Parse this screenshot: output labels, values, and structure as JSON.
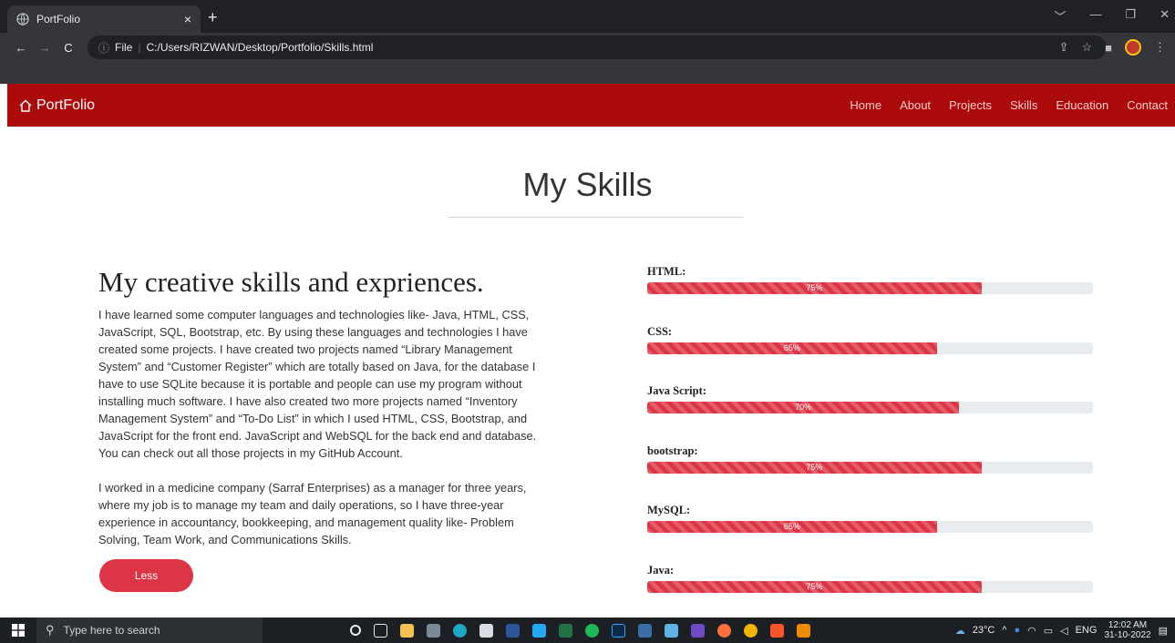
{
  "browser": {
    "tab_title": "PortFolio",
    "tab_close": "×",
    "new_tab": "+",
    "address_scheme": "File",
    "address_path": "C:/Users/RIZWAN/Desktop/Portfolio/Skills.html",
    "window_controls": [
      "﹀",
      "—",
      "❐",
      "✕"
    ]
  },
  "nav": {
    "brand": "PortFolio",
    "links": [
      "Home",
      "About",
      "Projects",
      "Skills",
      "Education",
      "Contact"
    ]
  },
  "page": {
    "title": "My Skills",
    "intro_heading": "My creative skills and expriences.",
    "paragraph1": "I have learned some computer languages and technologies like- Java, HTML, CSS, JavaScript, SQL, Bootstrap, etc. By using these languages and technologies I have created some projects. I have created two projects named “Library Management System” and “Customer Register” which are totally based on Java, for the database I have to use SQLite because it is portable and people can use my program without installing much software. I have also created two more projects named “Inventory Management System” and “To-Do List” in which I used HTML, CSS, Bootstrap, and JavaScript for the front end. JavaScript and WebSQL for the back end and database. You can check out all those projects in my GitHub Account.",
    "paragraph2": "I worked in a medicine company (Sarraf Enterprises) as a manager for three years, where my job is to manage my team and daily operations, so I have three-year experience in accountancy, bookkeeping, and management quality like- Problem Solving, Team Work, and Communications Skills.",
    "less_label": "Less"
  },
  "skills": [
    {
      "name": "HTML:",
      "percent": 75,
      "label": "75%"
    },
    {
      "name": "CSS:",
      "percent": 65,
      "label": "65%"
    },
    {
      "name": "Java Script:",
      "percent": 70,
      "label": "70%"
    },
    {
      "name": "bootstrap:",
      "percent": 75,
      "label": "75%"
    },
    {
      "name": "MySQL:",
      "percent": 65,
      "label": "65%"
    },
    {
      "name": "Java:",
      "percent": 75,
      "label": "75%"
    }
  ],
  "colors": {
    "nav_bg": "#ab0b0b",
    "accent": "#dc3545",
    "track": "#e9ecef"
  },
  "taskbar": {
    "search_placeholder": "Type here to search",
    "temperature": "23°C",
    "language": "ENG",
    "time": "12:02 AM",
    "date": "31-10-2022",
    "app_icons": [
      "cortana-icon",
      "task-view-icon",
      "file-explorer-icon",
      "calculator-icon",
      "edge-icon",
      "store-icon",
      "word-icon",
      "vscode-icon",
      "excel-icon",
      "spotify-icon",
      "photoshop-icon",
      "app-icon",
      "app-icon",
      "app-icon",
      "firefox-icon",
      "chrome-icon",
      "brave-icon",
      "vlc-icon"
    ]
  }
}
